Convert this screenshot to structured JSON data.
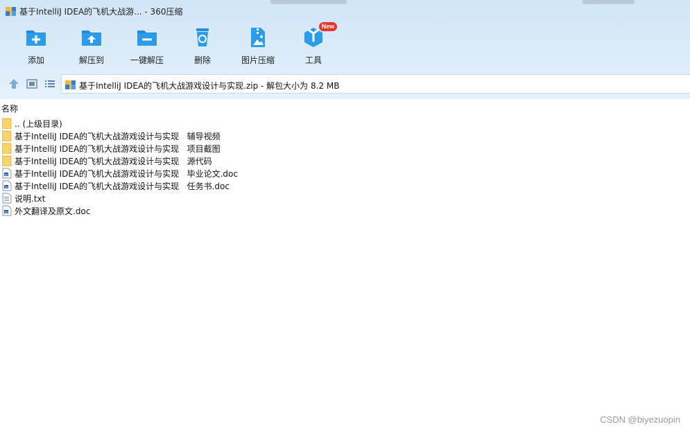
{
  "window": {
    "title": "基于IntelliJ IDEA的飞机大战游... - 360压缩"
  },
  "toolbar": {
    "items": [
      {
        "label": "添加",
        "icon": "add-folder-icon"
      },
      {
        "label": "解压到",
        "icon": "extract-to-icon"
      },
      {
        "label": "一键解压",
        "icon": "one-click-extract-icon"
      },
      {
        "label": "删除",
        "icon": "recycle-bin-icon"
      },
      {
        "label": "图片压缩",
        "icon": "image-compress-icon"
      },
      {
        "label": "工具",
        "icon": "tools-cube-icon",
        "badge": "New"
      }
    ]
  },
  "navbar": {
    "path": "基于IntelliJ IDEA的飞机大战游戏设计与实现.zip - 解包大小为 8.2 MB",
    "buttons": [
      "up-arrow-icon",
      "thumbnail-view-icon",
      "list-view-icon"
    ]
  },
  "list": {
    "column_header": "名称",
    "items": [
      {
        "name": ".. (上级目录)",
        "type": "folder"
      },
      {
        "name": "基于IntelliJ IDEA的飞机大战游戏设计与实现   辅导视频",
        "type": "folder"
      },
      {
        "name": "基于IntelliJ IDEA的飞机大战游戏设计与实现   项目截图",
        "type": "folder"
      },
      {
        "name": "基于IntelliJ IDEA的飞机大战游戏设计与实现   源代码",
        "type": "folder"
      },
      {
        "name": "基于IntelliJ IDEA的飞机大战游戏设计与实现   毕业论文.doc",
        "type": "doc"
      },
      {
        "name": "基于IntelliJ IDEA的飞机大战游戏设计与实现   任务书.doc",
        "type": "doc"
      },
      {
        "name": "说明.txt",
        "type": "txt"
      },
      {
        "name": "外文翻译及原文.doc",
        "type": "doc"
      }
    ]
  },
  "watermark": "CSDN @biyezuopin",
  "colors": {
    "accent_blue": "#1e8fe0",
    "folder_yellow": "#f6d36b",
    "badge_red": "#e8322c"
  }
}
